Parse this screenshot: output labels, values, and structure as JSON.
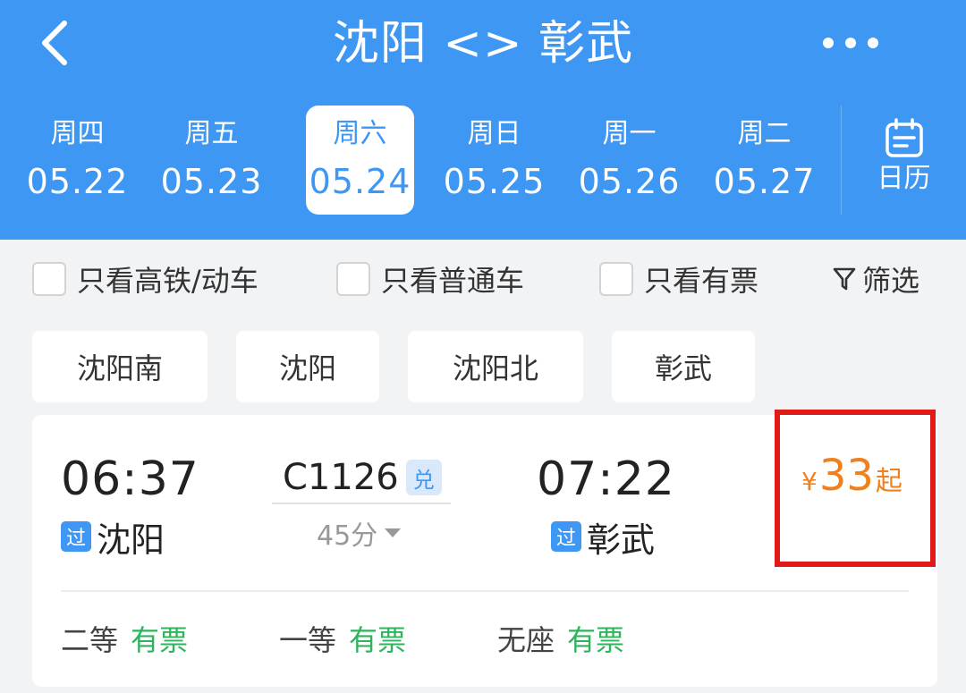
{
  "header": {
    "title": "沈阳 <> 彰武",
    "back_icon": "chevron-left-icon",
    "more_icon": "more-horizontal-icon"
  },
  "dates": [
    {
      "weekday": "周四",
      "date": "05.22",
      "selected": false
    },
    {
      "weekday": "周五",
      "date": "05.23",
      "selected": false
    },
    {
      "weekday": "周六",
      "date": "05.24",
      "selected": true
    },
    {
      "weekday": "周日",
      "date": "05.25",
      "selected": false
    },
    {
      "weekday": "周一",
      "date": "05.26",
      "selected": false
    },
    {
      "weekday": "周二",
      "date": "05.27",
      "selected": false
    }
  ],
  "calendar": {
    "label": "日历",
    "icon": "calendar-icon"
  },
  "filters": {
    "high_speed_only": "只看高铁/动车",
    "regular_only": "只看普通车",
    "available_only": "只看有票",
    "filter_label": "筛选",
    "filter_icon": "funnel-icon"
  },
  "stations": [
    "沈阳南",
    "沈阳",
    "沈阳北",
    "彰武"
  ],
  "train": {
    "departure_time": "06:37",
    "departure_tag": "过",
    "departure_station": "沈阳",
    "train_number": "C1126",
    "exchange_badge": "兑",
    "duration": "45分",
    "arrival_time": "07:22",
    "arrival_tag": "过",
    "arrival_station": "彰武",
    "price_symbol": "¥",
    "price": "33",
    "price_suffix": "起",
    "seats": [
      {
        "name": "二等",
        "availability": "有票"
      },
      {
        "name": "一等",
        "availability": "有票"
      },
      {
        "name": "无座",
        "availability": "有票"
      }
    ]
  },
  "colors": {
    "header_blue": "#3d97f3",
    "price_orange": "#f0801c",
    "available_green": "#2fb35c",
    "highlight_red": "#e01919"
  }
}
